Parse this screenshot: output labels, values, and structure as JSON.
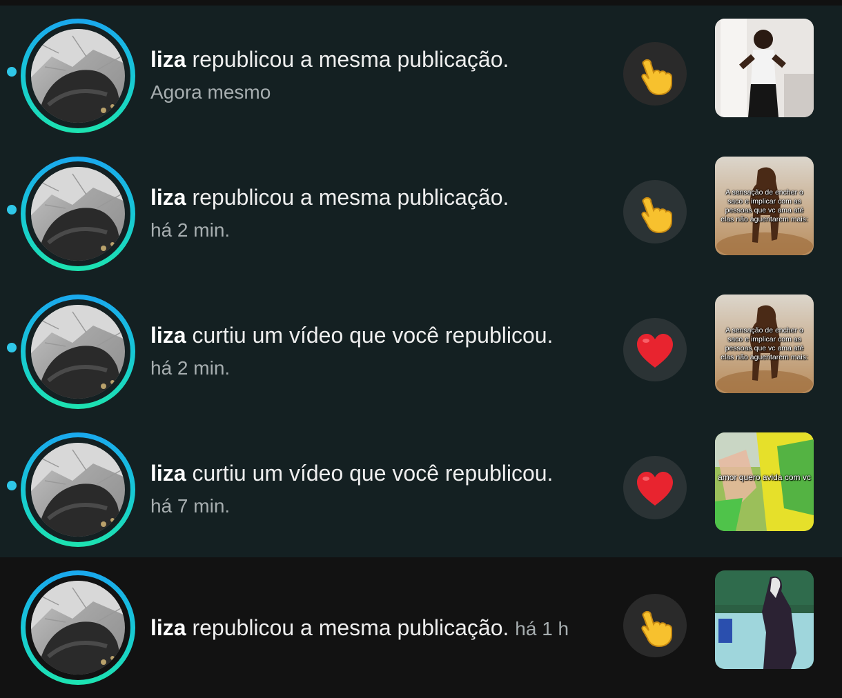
{
  "notifications": [
    {
      "username": "liza",
      "action": "republicou a mesma publicação.",
      "time": "Agora mesmo",
      "unread": true,
      "reaction_icon": "pointing-hand-icon",
      "thumbnail": "person-dancing-thumbnail"
    },
    {
      "username": "liza",
      "action": "republicou a mesma publicação.",
      "time": "há 2 min.",
      "unread": true,
      "reaction_icon": "pointing-hand-icon",
      "thumbnail": "horse-meme-thumbnail",
      "thumbnail_caption": "A sensação de encher o saco e implicar com as pessoas que vc ama até elas não aguentarem mais:"
    },
    {
      "username": "liza",
      "action": "curtiu um vídeo que você republicou.",
      "time": "há 2 min.",
      "unread": true,
      "reaction_icon": "red-heart-icon",
      "thumbnail": "horse-meme-thumbnail",
      "thumbnail_caption": "A sensação de encher o saco e implicar com as pessoas que vc ama até elas não aguentarem mais:"
    },
    {
      "username": "liza",
      "action": "curtiu um vídeo que você republicou.",
      "time": "há 7 min.",
      "unread": true,
      "reaction_icon": "red-heart-icon",
      "thumbnail": "green-shirt-thumbnail",
      "thumbnail_caption": "amor quero    avida com vc"
    },
    {
      "username": "liza",
      "action": "republicou a mesma publicação.",
      "time": "há 1 h",
      "unread": false,
      "reaction_icon": "pointing-hand-icon",
      "thumbnail": "classroom-thumbnail"
    }
  ],
  "colors": {
    "unread_background": "#142022",
    "read_background": "#121212",
    "unread_dot": "#2fc7e8",
    "ring_gradient": [
      "#1aa8ee",
      "#1de3b0"
    ],
    "reaction_circle": "#2b3335",
    "heart": "#e8242f",
    "hand": "#f7c12e"
  }
}
